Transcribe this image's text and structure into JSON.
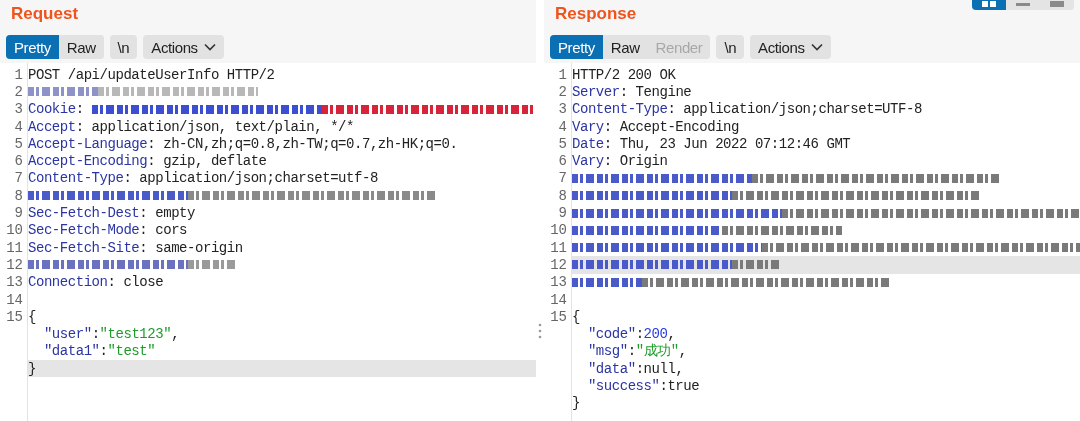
{
  "view_toggles": [
    {
      "selected": true
    },
    {
      "selected": false
    },
    {
      "selected": false
    }
  ],
  "panes": [
    {
      "title": "Request",
      "tabs": [
        {
          "label": "Pretty",
          "selected": true,
          "disabled": false
        },
        {
          "label": "Raw",
          "selected": false,
          "disabled": false
        }
      ],
      "newline_button": "\\n",
      "actions_button": "Actions",
      "lines": [
        {
          "number": "1",
          "highlighted": false,
          "segments": [
            {
              "kind": "plain",
              "text": "POST /api/updateUserInfo HTTP/2"
            }
          ]
        },
        {
          "number": "2",
          "highlighted": false,
          "segments": [
            {
              "kind": "redacted",
              "color": "#8d93c9"
            },
            {
              "kind": "redacted",
              "color": "#b8b8b8"
            }
          ]
        },
        {
          "number": "3",
          "highlighted": false,
          "segments": [
            {
              "kind": "key",
              "text": "Cookie"
            },
            {
              "kind": "plain",
              "text": ": "
            },
            {
              "kind": "redacted",
              "color": "#3c4fd0"
            },
            {
              "kind": "redacted",
              "color": "#d8243a"
            }
          ]
        },
        {
          "number": "4",
          "highlighted": false,
          "segments": [
            {
              "kind": "key",
              "text": "Accept"
            },
            {
              "kind": "plain",
              "text": ": application/json, text/plain, */*"
            }
          ]
        },
        {
          "number": "5",
          "highlighted": false,
          "segments": [
            {
              "kind": "key",
              "text": "Accept-Language"
            },
            {
              "kind": "plain",
              "text": ": zh-CN,zh;q=0.8,zh-TW;q=0.7,zh-HK;q=0."
            }
          ]
        },
        {
          "number": "6",
          "highlighted": false,
          "segments": [
            {
              "kind": "key",
              "text": "Accept-Encoding"
            },
            {
              "kind": "plain",
              "text": ": gzip, deflate"
            }
          ]
        },
        {
          "number": "7",
          "highlighted": false,
          "segments": [
            {
              "kind": "key",
              "text": "Content-Type"
            },
            {
              "kind": "plain",
              "text": ": application/json;charset=utf-8"
            }
          ]
        },
        {
          "number": "8",
          "highlighted": false,
          "segments": [
            {
              "kind": "redacted",
              "color": "#4a5ac8"
            },
            {
              "kind": "redacted",
              "color": "#8a8a8a"
            }
          ]
        },
        {
          "number": "9",
          "highlighted": false,
          "segments": [
            {
              "kind": "key",
              "text": "Sec-Fetch-Dest"
            },
            {
              "kind": "plain",
              "text": ": empty"
            }
          ]
        },
        {
          "number": "10",
          "highlighted": false,
          "segments": [
            {
              "kind": "key",
              "text": "Sec-Fetch-Mode"
            },
            {
              "kind": "plain",
              "text": ": cors"
            }
          ]
        },
        {
          "number": "11",
          "highlighted": false,
          "segments": [
            {
              "kind": "key",
              "text": "Sec-Fetch-Site"
            },
            {
              "kind": "plain",
              "text": ": same-origin"
            }
          ]
        },
        {
          "number": "12",
          "highlighted": false,
          "segments": [
            {
              "kind": "redacted",
              "color": "#6a72c0"
            },
            {
              "kind": "redacted",
              "color": "#9a9a9a"
            }
          ]
        },
        {
          "number": "13",
          "highlighted": false,
          "segments": [
            {
              "kind": "key",
              "text": "Connection"
            },
            {
              "kind": "plain",
              "text": ": close"
            }
          ]
        },
        {
          "number": "14",
          "highlighted": false
        },
        {
          "number": "15",
          "highlighted": false,
          "segments": [
            {
              "kind": "plain",
              "text": "{"
            }
          ]
        },
        {
          "highlighted": false,
          "segments": [
            {
              "kind": "key",
              "text": "  \"user\""
            },
            {
              "kind": "plain",
              "text": ":"
            },
            {
              "kind": "string",
              "text": "\"test123\""
            },
            {
              "kind": "plain",
              "text": ","
            }
          ]
        },
        {
          "highlighted": false,
          "segments": [
            {
              "kind": "key",
              "text": "  \"data1\""
            },
            {
              "kind": "plain",
              "text": ":"
            },
            {
              "kind": "string",
              "text": "\"test\""
            }
          ]
        },
        {
          "highlighted": true,
          "segments": [
            {
              "kind": "plain",
              "text": "}"
            }
          ]
        }
      ]
    },
    {
      "title": "Response",
      "tabs": [
        {
          "label": "Pretty",
          "selected": true,
          "disabled": false
        },
        {
          "label": "Raw",
          "selected": false,
          "disabled": false
        },
        {
          "label": "Render",
          "selected": false,
          "disabled": true
        }
      ],
      "newline_button": "\\n",
      "actions_button": "Actions",
      "lines": [
        {
          "number": "1",
          "highlighted": false,
          "segments": [
            {
              "kind": "plain",
              "text": "HTTP/2 200 OK"
            }
          ]
        },
        {
          "number": "2",
          "highlighted": false,
          "segments": [
            {
              "kind": "key",
              "text": "Server"
            },
            {
              "kind": "plain",
              "text": ": Tengine"
            }
          ]
        },
        {
          "number": "3",
          "highlighted": false,
          "segments": [
            {
              "kind": "key",
              "text": "Content-Type"
            },
            {
              "kind": "plain",
              "text": ": application/json;charset=UTF-8"
            }
          ]
        },
        {
          "number": "4",
          "highlighted": false,
          "segments": [
            {
              "kind": "key",
              "text": "Vary"
            },
            {
              "kind": "plain",
              "text": ": Accept-Encoding"
            }
          ]
        },
        {
          "number": "5",
          "highlighted": false,
          "segments": [
            {
              "kind": "key",
              "text": "Date"
            },
            {
              "kind": "plain",
              "text": ": Thu, 23 Jun 2022 07:12:46 GMT"
            }
          ]
        },
        {
          "number": "6",
          "highlighted": false,
          "segments": [
            {
              "kind": "key",
              "text": "Vary"
            },
            {
              "kind": "plain",
              "text": ": Origin"
            }
          ]
        },
        {
          "number": "7",
          "highlighted": false,
          "segments": [
            {
              "kind": "redacted",
              "color": "#4a5ac8"
            },
            {
              "kind": "redacted",
              "color": "#7a7a7a"
            }
          ]
        },
        {
          "number": "8",
          "highlighted": false,
          "segments": [
            {
              "kind": "redacted",
              "color": "#4a5ac8"
            },
            {
              "kind": "redacted",
              "color": "#7a7a7a"
            }
          ]
        },
        {
          "number": "9",
          "highlighted": false,
          "segments": [
            {
              "kind": "redacted",
              "color": "#4a5ac8"
            },
            {
              "kind": "redacted",
              "color": "#7a7a7a"
            }
          ]
        },
        {
          "number": "10",
          "highlighted": false,
          "segments": [
            {
              "kind": "redacted",
              "color": "#4a5ac8"
            },
            {
              "kind": "redacted",
              "color": "#7a7a7a"
            }
          ]
        },
        {
          "number": "11",
          "highlighted": false,
          "segments": [
            {
              "kind": "redacted",
              "color": "#4a5ac8"
            },
            {
              "kind": "redacted",
              "color": "#7a7a7a"
            }
          ]
        },
        {
          "number": "12",
          "highlighted": true,
          "segments": [
            {
              "kind": "redacted",
              "color": "#4a5ac8"
            },
            {
              "kind": "redacted",
              "color": "#7a7a7a"
            }
          ]
        },
        {
          "number": "13",
          "highlighted": false,
          "segments": [
            {
              "kind": "redacted",
              "color": "#4a5ac8"
            },
            {
              "kind": "redacted",
              "color": "#7a7a7a"
            }
          ]
        },
        {
          "number": "14",
          "highlighted": false
        },
        {
          "number": "15",
          "highlighted": false,
          "segments": [
            {
              "kind": "plain",
              "text": "{"
            }
          ]
        },
        {
          "highlighted": false,
          "segments": [
            {
              "kind": "key",
              "text": "  \"code\""
            },
            {
              "kind": "plain",
              "text": ":"
            },
            {
              "kind": "number",
              "text": "200"
            },
            {
              "kind": "plain",
              "text": ","
            }
          ]
        },
        {
          "highlighted": false,
          "segments": [
            {
              "kind": "key",
              "text": "  \"msg\""
            },
            {
              "kind": "plain",
              "text": ":"
            },
            {
              "kind": "string",
              "text": "\"成功\""
            },
            {
              "kind": "plain",
              "text": ","
            }
          ]
        },
        {
          "highlighted": false,
          "segments": [
            {
              "kind": "key",
              "text": "  \"data\""
            },
            {
              "kind": "plain",
              "text": ":null,"
            }
          ]
        },
        {
          "highlighted": false,
          "segments": [
            {
              "kind": "key",
              "text": "  \"success\""
            },
            {
              "kind": "plain",
              "text": ":true"
            }
          ]
        },
        {
          "highlighted": false,
          "segments": [
            {
              "kind": "plain",
              "text": "}"
            }
          ]
        }
      ]
    }
  ]
}
